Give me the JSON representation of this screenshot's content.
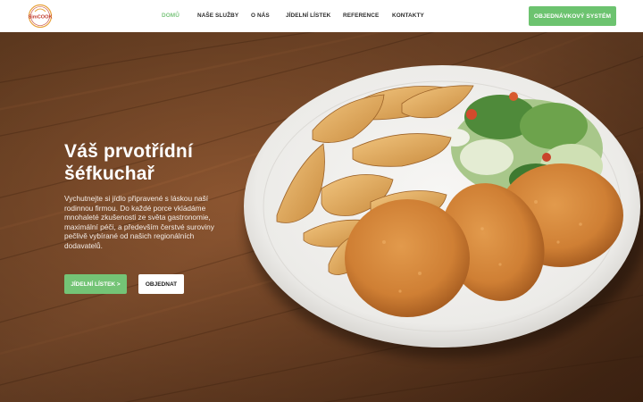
{
  "brand": {
    "logo_text": "SimCOOK"
  },
  "nav": {
    "items": [
      {
        "label": "DOMŮ",
        "active": true
      },
      {
        "label": "NAŠE SLUŽBY",
        "active": false
      },
      {
        "label": "O NÁS",
        "active": false
      },
      {
        "label": "JÍDELNÍ LÍSTEK",
        "active": false
      },
      {
        "label": "REFERENCE",
        "active": false
      },
      {
        "label": "KONTAKTY",
        "active": false
      }
    ],
    "order_system_label": "OBJEDNÁVKOVÝ SYSTÉM"
  },
  "hero": {
    "title": "Váš prvotřídní šéfkuchař",
    "description": "Vychutnejte si jídlo připravené s láskou naší rodinnou firmou. Do každé porce vkládáme mnohaleté zkušenosti ze světa gastronomie, maximální péči, a především čerstvé suroviny pečlivě vybírané od našich regionálních dodavatelů.",
    "menu_button": "JÍDELNÍ LÍSTEK >",
    "order_button": "OBJEDNAT"
  },
  "colors": {
    "accent_green": "#6cc36f",
    "nav_active": "#7cc67e",
    "header_bg": "#ffffff",
    "wood": "#6b3f22"
  }
}
